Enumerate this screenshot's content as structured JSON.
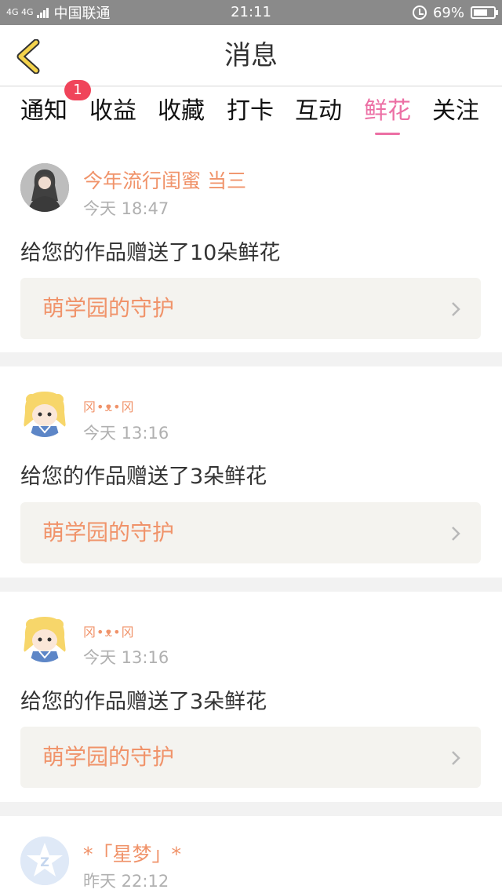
{
  "status_bar": {
    "network": "4G 4G",
    "carrier": "中国联通",
    "time": "21:11",
    "battery": "69%",
    "battery_level": 0.69
  },
  "header": {
    "title": "消息",
    "back_icon": "chevron-left-icon",
    "accent_color": "#f4d34c"
  },
  "tabs": {
    "items": [
      {
        "label": "通知"
      },
      {
        "label": "收益"
      },
      {
        "label": "收藏"
      },
      {
        "label": "打卡"
      },
      {
        "label": "互动"
      },
      {
        "label": "鲜花"
      },
      {
        "label": "关注"
      }
    ],
    "active": "鲜花",
    "badge": "1",
    "active_color": "#ec6fa4"
  },
  "messages": [
    {
      "user": "今年流行闺蜜 当三",
      "time": "今天 18:47",
      "text": "给您的作品赠送了10朵鲜花",
      "link": "萌学园的守护"
    },
    {
      "user": "冈•ᴥ•冈",
      "time": "今天 13:16",
      "text": "给您的作品赠送了3朵鲜花",
      "link": "萌学园的守护"
    },
    {
      "user": "冈•ᴥ•冈",
      "time": "今天 13:16",
      "text": "给您的作品赠送了3朵鲜花",
      "link": "萌学园的守护"
    },
    {
      "user": "*「星梦」*",
      "time": "昨天 22:12"
    }
  ],
  "colors": {
    "name": "#f0936a",
    "time": "#b0b0b0",
    "link_bg": "#f4f3ef",
    "badge": "#f0445a"
  }
}
